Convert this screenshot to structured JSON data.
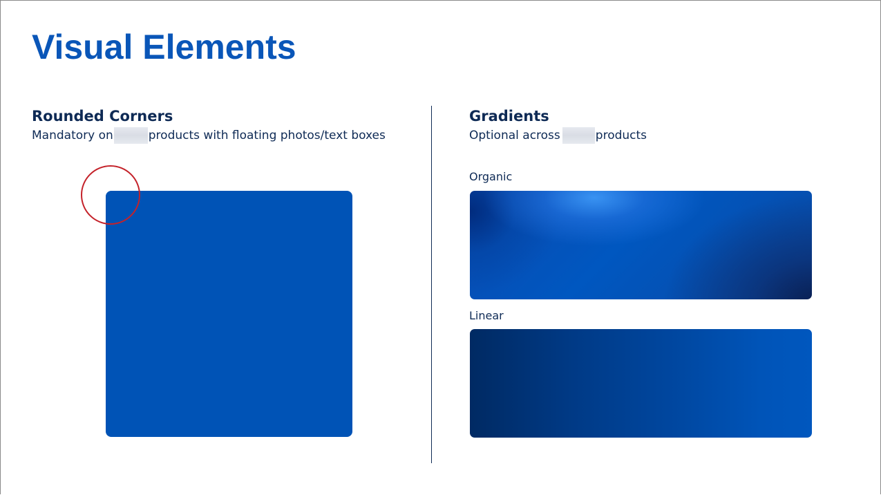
{
  "page": {
    "title": "Visual Elements"
  },
  "left_section": {
    "heading": "Rounded Corners",
    "subtext_before": "Mandatory on",
    "subtext_after": "products with floating photos/text boxes"
  },
  "right_section": {
    "heading": "Gradients",
    "subtext_before": "Optional across",
    "subtext_after": "products",
    "organic_label": "Organic",
    "linear_label": "Linear"
  },
  "colors": {
    "title": "#0a56b8",
    "text": "#0e2a55",
    "brand_blue": "#0053b6",
    "highlight_red": "#c4222a"
  }
}
